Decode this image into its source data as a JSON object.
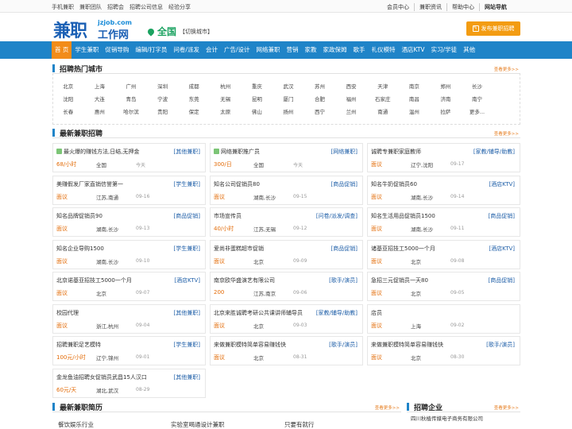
{
  "topbar": {
    "left": [
      "手机兼职",
      "兼职团队",
      "招聘会",
      "招聘公司信息",
      "经验分享"
    ],
    "right": [
      "会员中心",
      "兼职资讯",
      "帮助中心",
      "网站导航"
    ]
  },
  "header": {
    "logo_main": "兼职",
    "logo_url": "jzjob.com",
    "logo_sub": "工作网",
    "city": "全国",
    "city_switch": "【切换城市】",
    "post_button": "发布兼职招聘"
  },
  "nav": [
    "首 页",
    "学生兼职",
    "促销导购",
    "编辑/打字员",
    "问卷/派发",
    "会计",
    "广告/设计",
    "网络兼职",
    "营销",
    "家教",
    "家政保姆",
    "歌手",
    "礼仪模特",
    "酒店KTV",
    "实习/学徒",
    "其他"
  ],
  "hot_city": {
    "title": "招聘热门城市",
    "more": "查看更多>>",
    "rows": [
      [
        "北京",
        "上海",
        "广州",
        "深圳",
        "成都",
        "杭州",
        "重庆",
        "武汉",
        "苏州",
        "西安",
        "天津",
        "南京",
        "郑州",
        "长沙"
      ],
      [
        "沈阳",
        "大连",
        "青岛",
        "宁波",
        "东莞",
        "无锡",
        "昆明",
        "厦门",
        "合肥",
        "福州",
        "石家庄",
        "南昌",
        "济南",
        "南宁"
      ],
      [
        "长春",
        "惠州",
        "哈尔滨",
        "贵阳",
        "保定",
        "太原",
        "佛山",
        "扬州",
        "西宁",
        "兰州",
        "南通",
        "温州",
        "拉萨",
        "更多..."
      ]
    ]
  },
  "latest_jobs": {
    "title": "最新兼职招聘",
    "more": "查看更多>>",
    "items": [
      {
        "title": "最火爆的赚钱方法,日结,无押金",
        "category": "[其他兼职]",
        "pay": "68/小时",
        "location": "全国",
        "date": "今天",
        "icon": true
      },
      {
        "title": "网络兼职推广员",
        "category": "[网络兼职]",
        "pay": "300/日",
        "location": "全国",
        "date": "今天",
        "icon": true
      },
      {
        "title": "诚聘专兼职家庭教师",
        "category": "[家教/辅导/助教]",
        "pay": "面议",
        "location": "辽宁,沈阳",
        "date": "09-17",
        "icon": false
      },
      {
        "title": "美赚假发厂家直销信誉第一",
        "category": "[学生兼职]",
        "pay": "面议",
        "location": "江苏,南通",
        "date": "09-16",
        "icon": false
      },
      {
        "title": "知名公司促销员80",
        "category": "[商品促销]",
        "pay": "面议",
        "location": "湖南,长沙",
        "date": "09-15",
        "icon": false
      },
      {
        "title": "知名牛奶促销员60",
        "category": "[酒店KTV]",
        "pay": "面议",
        "location": "湖南,长沙",
        "date": "09-14",
        "icon": false
      },
      {
        "title": "知名品牌促销员90",
        "category": "[商品促销]",
        "pay": "面议",
        "location": "湖南,长沙",
        "date": "09-13",
        "icon": false
      },
      {
        "title": "市场宣传员",
        "category": "[问卷/派发/调查]",
        "pay": "40/小时",
        "location": "江苏,无锡",
        "date": "09-12",
        "icon": false
      },
      {
        "title": "知名生活用品促销员1500",
        "category": "[商品促销]",
        "pay": "面议",
        "location": "湖南,长沙",
        "date": "09-11",
        "icon": false
      },
      {
        "title": "知名企业导购1500",
        "category": "[学生兼职]",
        "pay": "面议",
        "location": "湖南,长沙",
        "date": "09-10",
        "icon": false
      },
      {
        "title": "爱尚非蛋糕超市促销",
        "category": "[商品促销]",
        "pay": "面议",
        "location": "北京",
        "date": "09-09",
        "icon": false
      },
      {
        "title": "诸基亚招技工5000一个月",
        "category": "[酒店KTV]",
        "pay": "面议",
        "location": "北京",
        "date": "09-08",
        "icon": false
      },
      {
        "title": "北京诺基亚招技工5000一个月",
        "category": "[酒店KTV]",
        "pay": "面议",
        "location": "北京",
        "date": "09-07",
        "icon": false
      },
      {
        "title": "南京欧华盛演艺有限公司",
        "category": "[歌手/演员]",
        "pay": "200",
        "location": "江苏,南京",
        "date": "09-06",
        "icon": false
      },
      {
        "title": "急招三元促销员一天80",
        "category": "[商品促销]",
        "pay": "面议",
        "location": "北京",
        "date": "09-05",
        "icon": false
      },
      {
        "title": "校园代理",
        "category": "[其他兼职]",
        "pay": "面议",
        "location": "浙江,杭州",
        "date": "09-04",
        "icon": false
      },
      {
        "title": "北京来胜诚聘考研公共课讲师辅导员",
        "category": "[家教/辅导/助教]",
        "pay": "面议",
        "location": "北京",
        "date": "09-03",
        "icon": false
      },
      {
        "title": "店员",
        "category": "",
        "pay": "面议",
        "location": "上海",
        "date": "09-02",
        "icon": false
      },
      {
        "title": "招聘兼职足艺模特",
        "category": "[学生兼职]",
        "pay": "100元/小时",
        "location": "辽宁,锦州",
        "date": "09-01",
        "icon": false
      },
      {
        "title": "来做兼职模特简单容易赚钱快",
        "category": "[歌手/演员]",
        "pay": "面议",
        "location": "北京",
        "date": "08-31",
        "icon": false
      },
      {
        "title": "来做兼职模特简单容易赚钱快",
        "category": "[歌手/演员]",
        "pay": "面议",
        "location": "北京",
        "date": "08-30",
        "icon": false
      },
      {
        "title": "金龙鱼油招聘女促销员武昌15人汉口",
        "category": "[其他兼职]",
        "pay": "60元/天",
        "location": "湖北,武汉",
        "date": "08-29",
        "icon": false
      }
    ]
  },
  "resume": {
    "title": "最新兼职简历",
    "more": "查看更多>>",
    "items": [
      "餐饮娱乐行业",
      "实验室喝通设计兼职",
      "只要有就行"
    ]
  },
  "company": {
    "title": "招聘企业",
    "more": "查看更多>>",
    "items": [
      "四川秋植传媒电子商务有限公司"
    ]
  }
}
